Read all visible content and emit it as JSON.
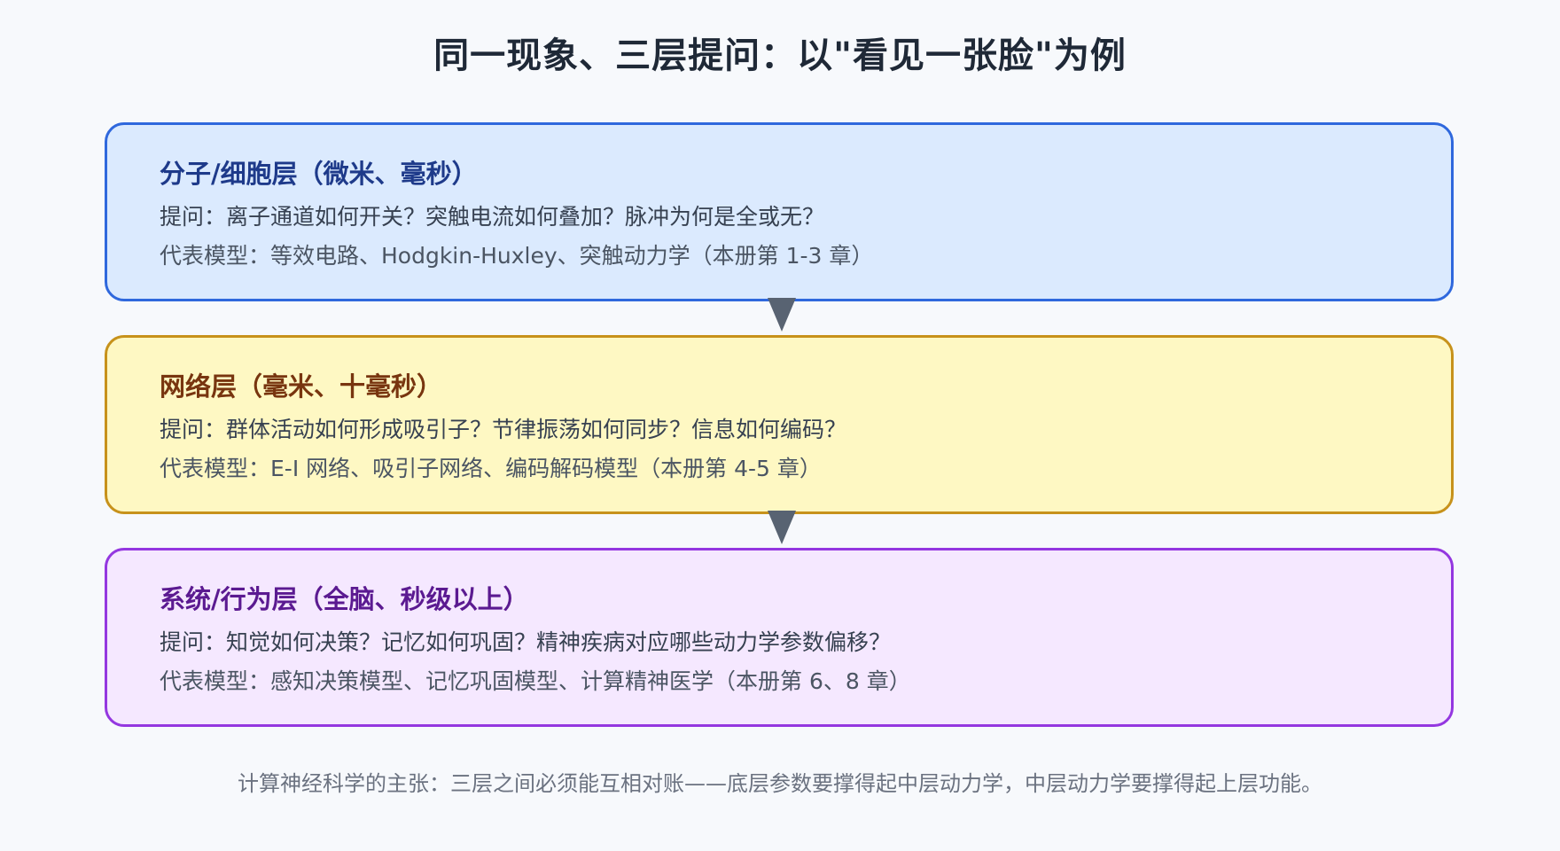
{
  "title": "同一现象、三层提问：以\"看见一张脸\"为例",
  "layers": [
    {
      "heading": "分子/细胞层（微米、毫秒）",
      "question": "提问：离子通道如何开关？突触电流如何叠加？脉冲为何是全或无？",
      "models": "代表模型：等效电路、Hodgkin-Huxley、突触动力学（本册第 1-3 章）",
      "colors": {
        "border": "#2f68dd",
        "fill": "#dbeafe",
        "heading": "#1e3a8a"
      }
    },
    {
      "heading": "网络层（毫米、十毫秒）",
      "question": "提问：群体活动如何形成吸引子？节律振荡如何同步？信息如何编码？",
      "models": "代表模型：E-I 网络、吸引子网络、编码解码模型（本册第 4-5 章）",
      "colors": {
        "border": "#c7921b",
        "fill": "#fef8c3",
        "heading": "#78350f"
      }
    },
    {
      "heading": "系统/行为层（全脑、秒级以上）",
      "question": "提问：知觉如何决策？记忆如何巩固？精神疾病对应哪些动力学参数偏移？",
      "models": "代表模型：感知决策模型、记忆巩固模型、计算精神医学（本册第 6、8 章）",
      "colors": {
        "border": "#9437e0",
        "fill": "#f5e8ff",
        "heading": "#5b1a91"
      }
    }
  ],
  "arrow_color": "#586372",
  "footer": "计算神经科学的主张：三层之间必须能互相对账——底层参数要撑得起中层动力学，中层动力学要撑得起上层功能。"
}
